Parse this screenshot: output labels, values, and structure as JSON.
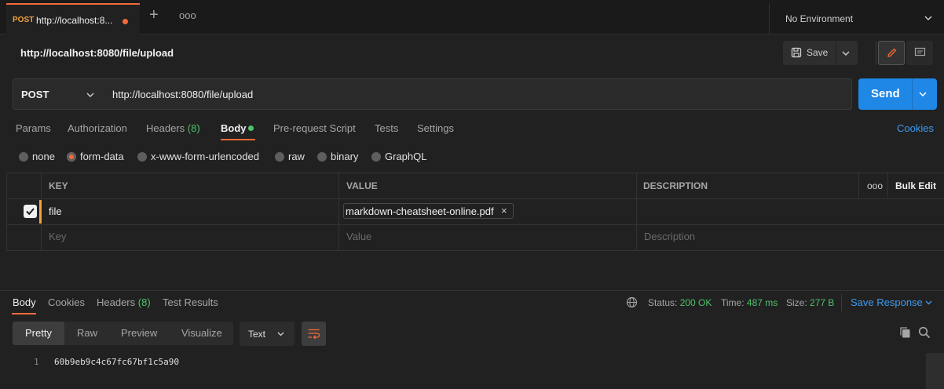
{
  "tab": {
    "method": "POST",
    "url": "http://localhost:8...",
    "new_tab_label": "+",
    "more_label": "ooo"
  },
  "environment": {
    "label": "No Environment"
  },
  "request": {
    "title": "http://localhost:8080/file/upload",
    "save_label": "Save",
    "method": "POST",
    "url": "http://localhost:8080/file/upload",
    "send_label": "Send"
  },
  "request_tabs": {
    "params": "Params",
    "authorization": "Authorization",
    "headers": "Headers",
    "headers_count": "(8)",
    "body": "Body",
    "prerequest": "Pre-request Script",
    "tests": "Tests",
    "settings": "Settings",
    "cookies": "Cookies"
  },
  "body_types": {
    "none": "none",
    "form_data": "form-data",
    "urlencoded": "x-www-form-urlencoded",
    "raw": "raw",
    "binary": "binary",
    "graphql": "GraphQL",
    "selected": "form-data"
  },
  "params_table": {
    "headers": {
      "key": "KEY",
      "value": "VALUE",
      "description": "DESCRIPTION",
      "more": "ooo",
      "bulk_edit": "Bulk Edit"
    },
    "rows": [
      {
        "checked": true,
        "key": "file",
        "value_file": "markdown-cheatsheet-online.pdf",
        "description": ""
      }
    ],
    "placeholders": {
      "key": "Key",
      "value": "Value",
      "description": "Description"
    }
  },
  "response": {
    "tabs": {
      "body": "Body",
      "cookies": "Cookies",
      "headers": "Headers",
      "headers_count": "(8)",
      "test_results": "Test Results"
    },
    "status_label": "Status:",
    "status_value": "200 OK",
    "time_label": "Time:",
    "time_value": "487 ms",
    "size_label": "Size:",
    "size_value": "277 B",
    "save_response": "Save Response",
    "view_modes": {
      "pretty": "Pretty",
      "raw": "Raw",
      "preview": "Preview",
      "visualize": "Visualize"
    },
    "format": "Text",
    "lines": [
      {
        "no": "1",
        "text": "60b9eb9c4c67fc67bf1c5a90"
      }
    ]
  },
  "colors": {
    "accent": "#f26b3a",
    "send": "#1f87e5",
    "link": "#3d9bf0",
    "success": "#4dc36c",
    "post": "#f4a23b"
  }
}
